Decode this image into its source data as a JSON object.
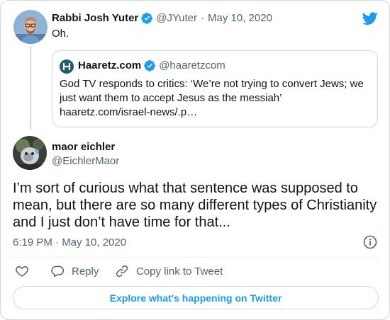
{
  "colors": {
    "accent": "#1d9bf0",
    "muted": "#536471",
    "text": "#0f1419",
    "border": "#cfd9de"
  },
  "parent_tweet": {
    "author_name": "Rabbi Josh Yuter",
    "handle": "@JYuter",
    "separator": "·",
    "date": "May 10, 2020",
    "text": "Oh."
  },
  "quoted_tweet": {
    "author_name": "Haaretz.com",
    "handle": "@haaretzcom",
    "lines": [
      "God TV responds to critics: ‘We’re not trying to convert Jews; we",
      "just want them to accept Jesus as the messiah’",
      "haaretz.com/israel-news/.p…"
    ]
  },
  "main_tweet": {
    "author_name": "maor eichler",
    "handle": "@EichlerMaor",
    "lines": [
      "I’m sort of curious what that sentence was supposed to",
      "mean, but there are so many different types of Christianity",
      "and I just don’t have time for that..."
    ],
    "timestamp": "6:19 PM · May 10, 2020"
  },
  "actions": {
    "reply": "Reply",
    "copy_link": "Copy link to Tweet"
  },
  "explore_button": "Explore what's happening on Twitter",
  "icons": {
    "logo": "twitter-bird-icon",
    "verified": "verified-badge-icon",
    "info": "info-icon",
    "like": "heart-icon",
    "reply": "speech-bubble-icon",
    "copy": "link-icon"
  }
}
